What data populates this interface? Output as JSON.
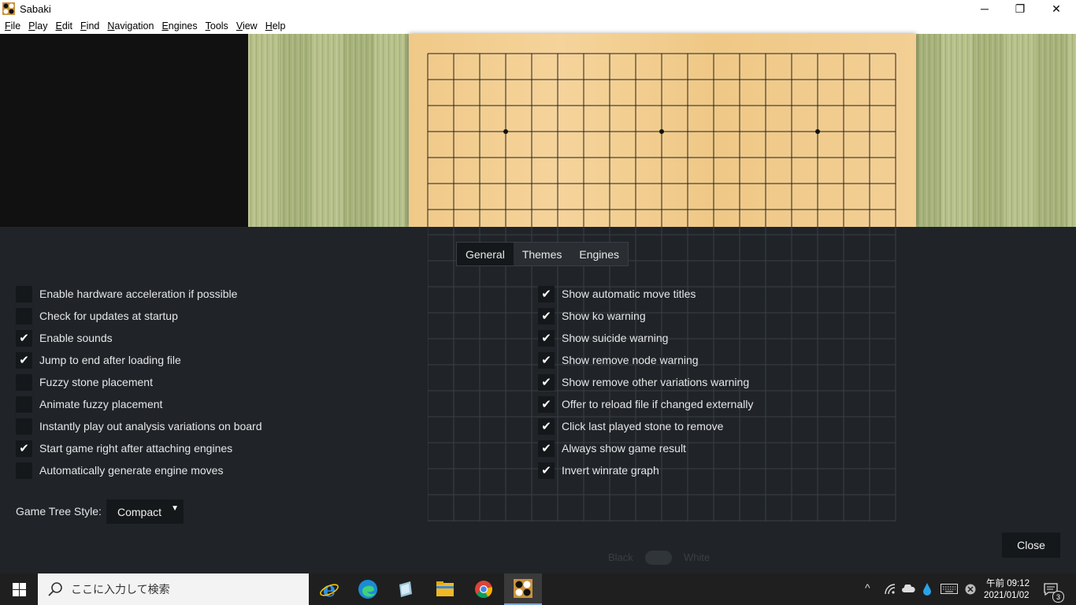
{
  "window": {
    "title": "Sabaki",
    "minimize": "─",
    "restore": "❐",
    "close": "✕"
  },
  "menu": [
    "File",
    "Play",
    "Edit",
    "Find",
    "Navigation",
    "Engines",
    "Tools",
    "View",
    "Help"
  ],
  "tabs": {
    "general": "General",
    "themes": "Themes",
    "engines": "Engines"
  },
  "left_options": [
    {
      "label": "Enable hardware acceleration if possible",
      "checked": false
    },
    {
      "label": "Check for updates at startup",
      "checked": false
    },
    {
      "label": "Enable sounds",
      "checked": true
    },
    {
      "label": "Jump to end after loading file",
      "checked": true
    },
    {
      "label": "Fuzzy stone placement",
      "checked": false
    },
    {
      "label": "Animate fuzzy placement",
      "checked": false
    },
    {
      "label": "Instantly play out analysis variations on board",
      "checked": false
    },
    {
      "label": "Start game right after attaching engines",
      "checked": true
    },
    {
      "label": "Automatically generate engine moves",
      "checked": false
    }
  ],
  "right_options": [
    {
      "label": "Show automatic move titles",
      "checked": true
    },
    {
      "label": "Show ko warning",
      "checked": true
    },
    {
      "label": "Show suicide warning",
      "checked": true
    },
    {
      "label": "Show remove node warning",
      "checked": true
    },
    {
      "label": "Show remove other variations warning",
      "checked": true
    },
    {
      "label": "Offer to reload file if changed externally",
      "checked": true
    },
    {
      "label": "Click last played stone to remove",
      "checked": true
    },
    {
      "label": "Always show game result",
      "checked": true
    },
    {
      "label": "Invert winrate graph",
      "checked": true
    }
  ],
  "game_tree": {
    "label": "Game Tree Style:",
    "value": "Compact",
    "arrow": "▼"
  },
  "close_label": "Close",
  "behind": {
    "black": "Black",
    "white": "White"
  },
  "taskbar": {
    "search_placeholder": "ここに入力して検索",
    "time": "午前 09:12",
    "date": "2021/01/02",
    "notifications": "3",
    "apps": [
      "internet-explorer",
      "edge",
      "app-store",
      "file-explorer",
      "chrome",
      "sabaki"
    ]
  },
  "colors": {
    "accent": "#7aa7d9",
    "overlay": "#21252a",
    "board": "#f3cf95"
  }
}
